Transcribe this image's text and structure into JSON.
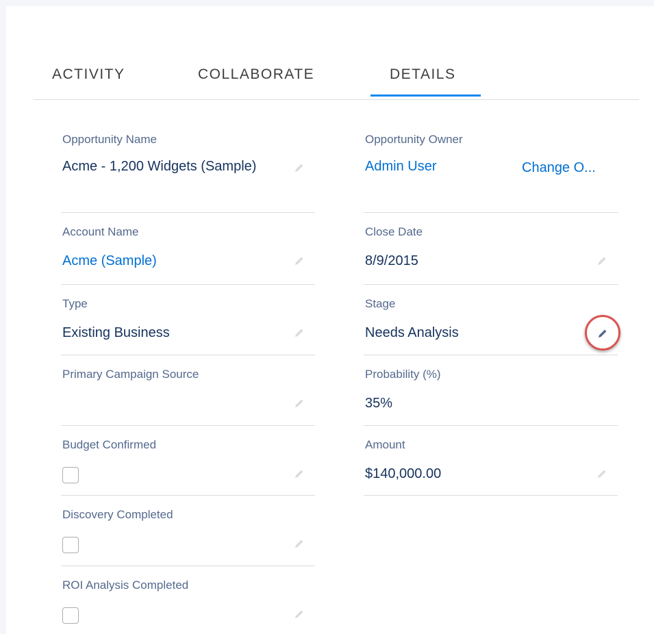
{
  "tabs": [
    {
      "label": "ACTIVITY",
      "active": false
    },
    {
      "label": "COLLABORATE",
      "active": false
    },
    {
      "label": "DETAILS",
      "active": true
    }
  ],
  "left_fields": [
    {
      "label": "Opportunity Name",
      "value": "Acme - 1,200 Widgets (Sample)",
      "type": "text"
    },
    {
      "label": "Account Name",
      "value": "Acme (Sample)",
      "type": "link"
    },
    {
      "label": "Type",
      "value": "Existing Business",
      "type": "text"
    },
    {
      "label": "Primary Campaign Source",
      "value": "",
      "type": "text"
    },
    {
      "label": "Budget Confirmed",
      "checked": false,
      "type": "checkbox"
    },
    {
      "label": "Discovery Completed",
      "checked": false,
      "type": "checkbox"
    },
    {
      "label": "ROI Analysis Completed",
      "checked": false,
      "type": "checkbox"
    }
  ],
  "right_fields": [
    {
      "label": "Opportunity Owner",
      "value": "Admin User",
      "type": "link",
      "action_label": "Change O..."
    },
    {
      "label": "Close Date",
      "value": "8/9/2015",
      "type": "text"
    },
    {
      "label": "Stage",
      "value": "Needs Analysis",
      "type": "text",
      "highlighted": true
    },
    {
      "label": "Probability (%)",
      "value": "35%",
      "type": "text"
    },
    {
      "label": "Amount",
      "value": "$140,000.00",
      "type": "text"
    }
  ],
  "colors": {
    "link": "#0070d2",
    "tab_active_underline": "#1589ee",
    "highlight_circle": "#d9534f"
  },
  "icons": {
    "edit": "pencil-icon"
  }
}
